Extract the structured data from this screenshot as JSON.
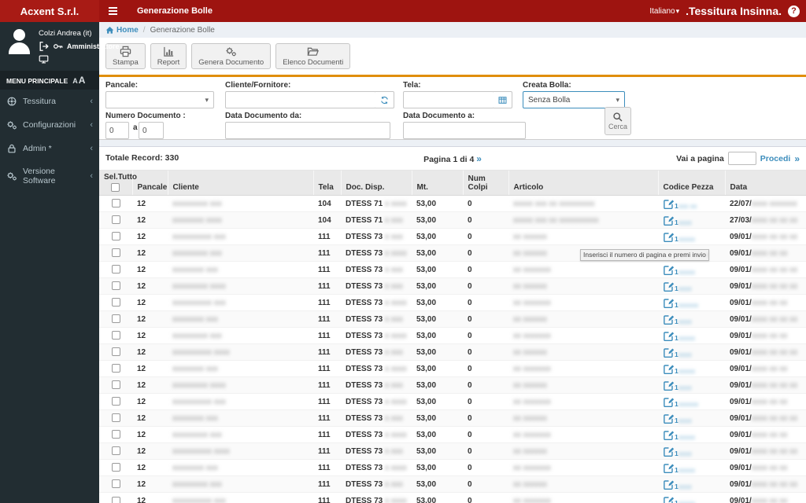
{
  "colors": {
    "accent": "#3c8dbc",
    "header_red": "#9e1410",
    "logo_red": "#a81b15",
    "sidebar_bg": "#222d32",
    "orange_divider": "#e08e0b"
  },
  "topbar": {
    "app_name": "Acxent S.r.l.",
    "page_title": "Generazione Bolle",
    "language": "Italiano",
    "brand": ".Tessitura Insinna.",
    "help": "?"
  },
  "sidebar": {
    "user_name": "Colzi Andrea (it)",
    "user_role": "Amministratore",
    "menu_header": "MENU PRINCIPALE",
    "font_small": "A",
    "font_large": "A",
    "items": [
      {
        "label": "Tessitura"
      },
      {
        "label": "Configurazioni"
      },
      {
        "label": "Admin *"
      },
      {
        "label": "Versione Software"
      }
    ]
  },
  "breadcrumb": {
    "home": "Home",
    "separator": "/",
    "current": "Generazione Bolle"
  },
  "toolbar": {
    "stampa": "Stampa",
    "report": "Report",
    "genera": "Genera Documento",
    "elenco": "Elenco Documenti"
  },
  "filters": {
    "pancale_label": "Pancale:",
    "cliente_label": "Cliente/Fornitore:",
    "tela_label": "Tela:",
    "creata_label": "Creata Bolla:",
    "creata_value": "Senza Bolla",
    "numero_label": "Numero Documento :",
    "numero_da": "0",
    "numero_sep": "a",
    "numero_a": "0",
    "data_da_label": "Data Documento da:",
    "data_a_label": "Data Documento a:",
    "cerca_label": "Cerca"
  },
  "paging": {
    "totale": "Totale Record: 330",
    "pagina": "Pagina 1 di 4",
    "next": "»",
    "vai": "Vai a pagina",
    "procedi": "Procedi",
    "page_input_value": ""
  },
  "tooltip": {
    "text": "Inserisci il numero di pagina e premi invio",
    "masked_tail": "xxxxxx"
  },
  "table": {
    "headers": {
      "sel": "Sel.Tutto",
      "pancale": "Pancale",
      "cliente": "Cliente",
      "tela": "Tela",
      "doc": "Doc. Disp.",
      "mt": "Mt.",
      "colpi": "Num Colpi",
      "articolo": "Articolo",
      "pezza": "Codice Pezza",
      "data": "Data"
    },
    "rows": [
      {
        "pancale": "12",
        "cliente_masked": "xxxxxxxxx xxx",
        "tela": "104",
        "doc": "DTESS 71",
        "doc_masked": "x xxxx",
        "mt": "53,00",
        "colpi": "0",
        "articolo_masked": "xxxxx xxx xx xxxxxxxxx",
        "pezza_prefix": "1",
        "pezza_masked": "xxx xx",
        "data": "22/07/",
        "data_masked": "xxxx xxxxxxx"
      },
      {
        "pancale": "12",
        "cliente_masked": "xxxxxxxx xxxx",
        "tela": "104",
        "doc": "DTESS 71",
        "doc_masked": "x xxx",
        "mt": "53,00",
        "colpi": "0",
        "articolo_masked": "xxxxx xxx xx xxxxxxxxxx",
        "pezza_prefix": "1",
        "pezza_masked": "xxxx",
        "data": "27/03/",
        "data_masked": "xxxx xx xx xx"
      },
      {
        "pancale": "12",
        "cliente_masked": "xxxxxxxxxx xxx",
        "tela": "111",
        "doc": "DTESS 73",
        "doc_masked": "x xxx",
        "mt": "53,00",
        "colpi": "0",
        "articolo_masked": "xx xxxxxx",
        "pezza_prefix": "1",
        "pezza_masked": "xxxxx",
        "data": "09/01/",
        "data_masked": "xxxx xx xx xx"
      },
      {
        "pancale": "12",
        "cliente_masked": "xxxxxxxxx xxx",
        "tela": "111",
        "doc": "DTESS 73",
        "doc_masked": "x xxxx",
        "mt": "53,00",
        "colpi": "0",
        "articolo_masked": "xx xxxxxx",
        "pezza_prefix": "1",
        "pezza_masked": "xxxx",
        "data": "09/01/",
        "data_masked": "xxxx xx xx"
      },
      {
        "pancale": "12",
        "cliente_masked": "xxxxxxxx xxx",
        "tela": "111",
        "doc": "DTESS 73",
        "doc_masked": "x xxx",
        "mt": "53,00",
        "colpi": "0",
        "articolo_masked": "xx xxxxxxx",
        "pezza_prefix": "1",
        "pezza_masked": "xxxxx",
        "data": "09/01/",
        "data_masked": "xxxx xx xx xx"
      },
      {
        "pancale": "12",
        "cliente_masked": "xxxxxxxxx xxxx",
        "tela": "111",
        "doc": "DTESS 73",
        "doc_masked": "x xxx",
        "mt": "53,00",
        "colpi": "0",
        "articolo_masked": "xx xxxxxx",
        "pezza_prefix": "1",
        "pezza_masked": "xxxx",
        "data": "09/01/",
        "data_masked": "xxxx xx xx xx"
      },
      {
        "pancale": "12",
        "cliente_masked": "xxxxxxxxxx xxx",
        "tela": "111",
        "doc": "DTESS 73",
        "doc_masked": "x xxxx",
        "mt": "53,00",
        "colpi": "0",
        "articolo_masked": "xx xxxxxxx",
        "pezza_prefix": "1",
        "pezza_masked": "xxxxxx",
        "data": "09/01/",
        "data_masked": "xxxx xx xx"
      },
      {
        "pancale": "12",
        "cliente_masked": "xxxxxxxx xxx",
        "tela": "111",
        "doc": "DTESS 73",
        "doc_masked": "x xxx",
        "mt": "53,00",
        "colpi": "0",
        "articolo_masked": "xx xxxxxx",
        "pezza_prefix": "1",
        "pezza_masked": "xxxx",
        "data": "09/01/",
        "data_masked": "xxxx xx xx xx"
      },
      {
        "pancale": "12",
        "cliente_masked": "xxxxxxxxx xxx",
        "tela": "111",
        "doc": "DTESS 73",
        "doc_masked": "x xxxx",
        "mt": "53,00",
        "colpi": "0",
        "articolo_masked": "xx xxxxxxx",
        "pezza_prefix": "1",
        "pezza_masked": "xxxxx",
        "data": "09/01/",
        "data_masked": "xxxx xx xx"
      },
      {
        "pancale": "12",
        "cliente_masked": "xxxxxxxxxx xxxx",
        "tela": "111",
        "doc": "DTESS 73",
        "doc_masked": "x xxx",
        "mt": "53,00",
        "colpi": "0",
        "articolo_masked": "xx xxxxxx",
        "pezza_prefix": "1",
        "pezza_masked": "xxxx",
        "data": "09/01/",
        "data_masked": "xxxx xx xx xx"
      },
      {
        "pancale": "12",
        "cliente_masked": "xxxxxxxx xxx",
        "tela": "111",
        "doc": "DTESS 73",
        "doc_masked": "x xxxx",
        "mt": "53,00",
        "colpi": "0",
        "articolo_masked": "xx xxxxxxx",
        "pezza_prefix": "1",
        "pezza_masked": "xxxxx",
        "data": "09/01/",
        "data_masked": "xxxx xx xx"
      },
      {
        "pancale": "12",
        "cliente_masked": "xxxxxxxxx xxxx",
        "tela": "111",
        "doc": "DTESS 73",
        "doc_masked": "x xxx",
        "mt": "53,00",
        "colpi": "0",
        "articolo_masked": "xx xxxxxx",
        "pezza_prefix": "1",
        "pezza_masked": "xxxx",
        "data": "09/01/",
        "data_masked": "xxxx xx xx xx"
      },
      {
        "pancale": "12",
        "cliente_masked": "xxxxxxxxxx xxx",
        "tela": "111",
        "doc": "DTESS 73",
        "doc_masked": "x xxxx",
        "mt": "53,00",
        "colpi": "0",
        "articolo_masked": "xx xxxxxxx",
        "pezza_prefix": "1",
        "pezza_masked": "xxxxxx",
        "data": "09/01/",
        "data_masked": "xxxx xx xx"
      },
      {
        "pancale": "12",
        "cliente_masked": "xxxxxxxx xxx",
        "tela": "111",
        "doc": "DTESS 73",
        "doc_masked": "x xxx",
        "mt": "53,00",
        "colpi": "0",
        "articolo_masked": "xx xxxxxx",
        "pezza_prefix": "1",
        "pezza_masked": "xxxx",
        "data": "09/01/",
        "data_masked": "xxxx xx xx xx"
      },
      {
        "pancale": "12",
        "cliente_masked": "xxxxxxxxx xxx",
        "tela": "111",
        "doc": "DTESS 73",
        "doc_masked": "x xxxx",
        "mt": "53,00",
        "colpi": "0",
        "articolo_masked": "xx xxxxxxx",
        "pezza_prefix": "1",
        "pezza_masked": "xxxxx",
        "data": "09/01/",
        "data_masked": "xxxx xx xx"
      },
      {
        "pancale": "12",
        "cliente_masked": "xxxxxxxxxx xxxx",
        "tela": "111",
        "doc": "DTESS 73",
        "doc_masked": "x xxx",
        "mt": "53,00",
        "colpi": "0",
        "articolo_masked": "xx xxxxxx",
        "pezza_prefix": "1",
        "pezza_masked": "xxxx",
        "data": "09/01/",
        "data_masked": "xxxx xx xx xx"
      },
      {
        "pancale": "12",
        "cliente_masked": "xxxxxxxx xxx",
        "tela": "111",
        "doc": "DTESS 73",
        "doc_masked": "x xxxx",
        "mt": "53,00",
        "colpi": "0",
        "articolo_masked": "xx xxxxxxx",
        "pezza_prefix": "1",
        "pezza_masked": "xxxxx",
        "data": "09/01/",
        "data_masked": "xxxx xx xx"
      },
      {
        "pancale": "12",
        "cliente_masked": "xxxxxxxxx xxx",
        "tela": "111",
        "doc": "DTESS 73",
        "doc_masked": "x xxx",
        "mt": "53,00",
        "colpi": "0",
        "articolo_masked": "xx xxxxxx",
        "pezza_prefix": "1",
        "pezza_masked": "xxxx",
        "data": "09/01/",
        "data_masked": "xxxx xx xx xx"
      },
      {
        "pancale": "12",
        "cliente_masked": "xxxxxxxxxx xxx",
        "tela": "111",
        "doc": "DTESS 73",
        "doc_masked": "x xxxx",
        "mt": "53,00",
        "colpi": "0",
        "articolo_masked": "xx xxxxxxx",
        "pezza_prefix": "1",
        "pezza_masked": "xxxxx",
        "data": "09/01/",
        "data_masked": "xxxx xx xx"
      }
    ]
  }
}
